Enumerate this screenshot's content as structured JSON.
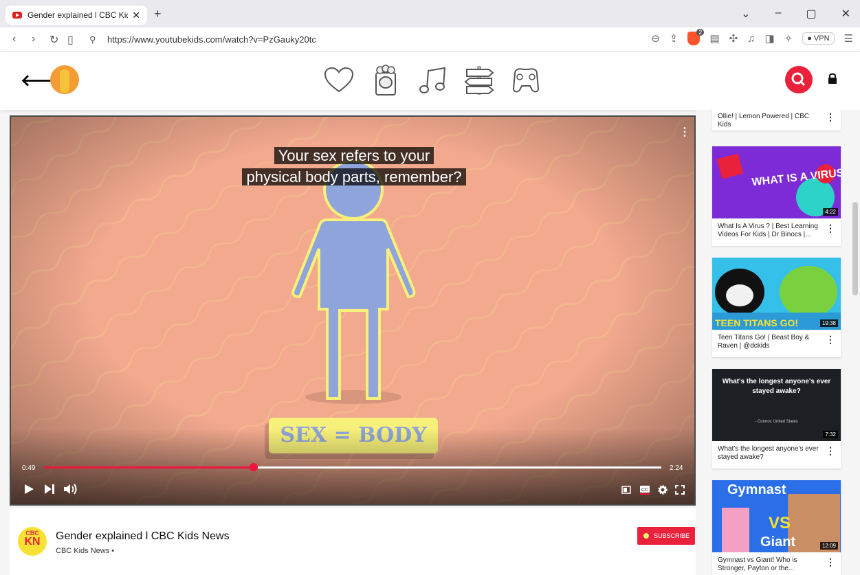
{
  "browser": {
    "tab_title": "Gender explained l CBC Kids N",
    "url": "https://www.youtubekids.com/watch?v=PzGauky20tc",
    "vpn_label": "VPN",
    "brave_badge": "2"
  },
  "icons": [
    "back-arrow-icon",
    "heart-icon",
    "popcorn-icon",
    "music-note-icon",
    "signpost-icon",
    "gamepad-icon",
    "search-icon",
    "lock-icon",
    "play-icon",
    "next-icon",
    "volume-icon",
    "miniplayer-icon",
    "captions-icon",
    "settings-icon",
    "fullscreen-icon"
  ],
  "colors": {
    "accent": "#e9213a",
    "progress": "#f0153c",
    "video_bg": "#f2a98e",
    "figure": "#8fa4db",
    "label_bg": "#f7f07a"
  },
  "player": {
    "caption_line1": "Your sex refers to your",
    "caption_line2": "physical body parts, remember?",
    "label": "SEX = BODY",
    "current_time": "0:49",
    "duration": "2:24",
    "progress_fraction": 0.34
  },
  "video": {
    "title": "Gender explained l CBC Kids News",
    "channel": "CBC Kids News •",
    "logo_top": "CBC",
    "logo_bottom": "KN",
    "subscribe_label": "SUBSCRIBE"
  },
  "sidebar": [
    {
      "title": "Ollie! | Lemon Powered | CBC Kids",
      "duration": ""
    },
    {
      "title": "What Is A Virus ? | Best Learning Videos For Kids | Dr Binocs |...",
      "duration": "4:22",
      "thumb_text": "WHAT IS A VIRUS?"
    },
    {
      "title": "Teen Titans Go! | Beast Boy & Raven | @dckids",
      "duration": "19:38",
      "thumb_text": "TEEN TITANS GO!"
    },
    {
      "title": "What's the longest anyone's ever stayed awake?",
      "duration": "7:32",
      "thumb_text": "What's the longest anyone's ever stayed awake?",
      "thumb_sub": "- Connor, United States"
    },
    {
      "title": "Gymnast vs Giant! Who is Stronger, Payton or the...",
      "duration": "12:09",
      "thumb_text": "Gymnast",
      "thumb_text2": "Giant"
    }
  ]
}
